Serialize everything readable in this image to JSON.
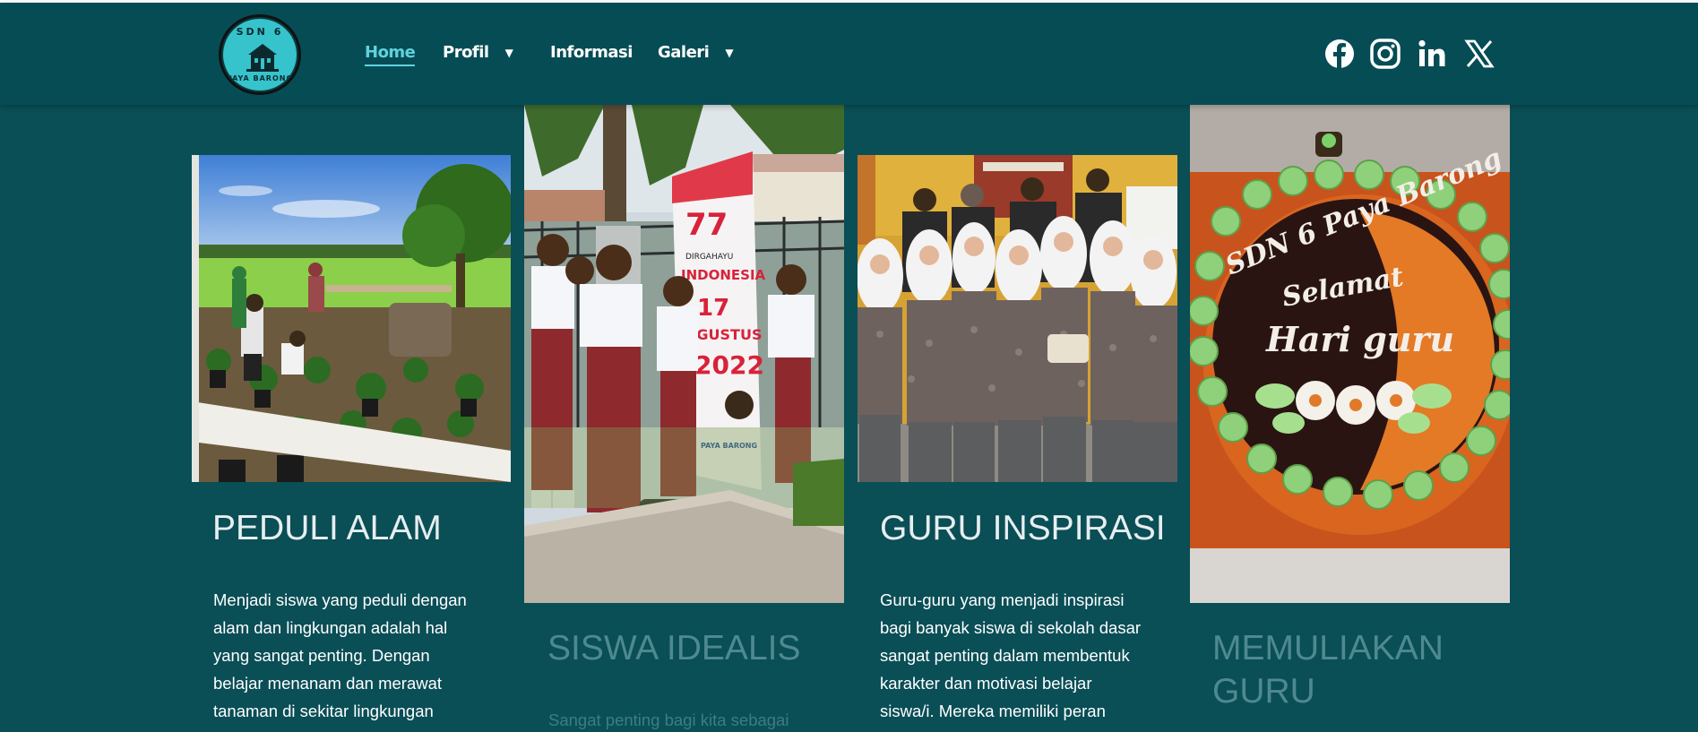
{
  "logo": {
    "top_text": "SDN 6",
    "bottom_text": "PAYA BARONG"
  },
  "nav": {
    "home": "Home",
    "profil": "Profil",
    "informasi": "Informasi",
    "galeri": "Galeri"
  },
  "social": [
    "facebook-icon",
    "instagram-icon",
    "linkedin-icon",
    "x-icon"
  ],
  "cards": [
    {
      "title": "PEDULI ALAM",
      "text_lines": [
        "Menjadi siswa yang peduli dengan",
        "alam dan lingkungan adalah hal",
        "yang sangat penting. Dengan",
        "belajar menanam dan merawat",
        "tanaman di sekitar lingkungan"
      ]
    },
    {
      "title": "SISWA IDEALIS",
      "text_lines": [
        "Sangat penting bagi kita sebagai"
      ],
      "poster": {
        "number": "77",
        "line1": "DIRGAHAYU",
        "line2": "INDONESIA",
        "line3": "17",
        "line4": "AGUSTUS",
        "line5": "2022",
        "footer": "PAYA BARONG"
      }
    },
    {
      "title": "GURU INSPIRASI",
      "text_lines": [
        "Guru-guru yang menjadi inspirasi",
        "bagi banyak siswa di sekolah dasar",
        "sangat penting dalam membentuk",
        "karakter dan motivasi belajar",
        "siswa/i. Mereka memiliki peran"
      ]
    },
    {
      "title_lines": [
        "MEMULIAKAN",
        "GURU"
      ],
      "cake": {
        "line1": "SDN 6 Paya Barong",
        "line2": "Selamat",
        "line3": "Hari guru"
      }
    }
  ],
  "colors": {
    "background": "#0a4e56",
    "navbar": "#064c55",
    "accent": "#5fd3dd"
  }
}
